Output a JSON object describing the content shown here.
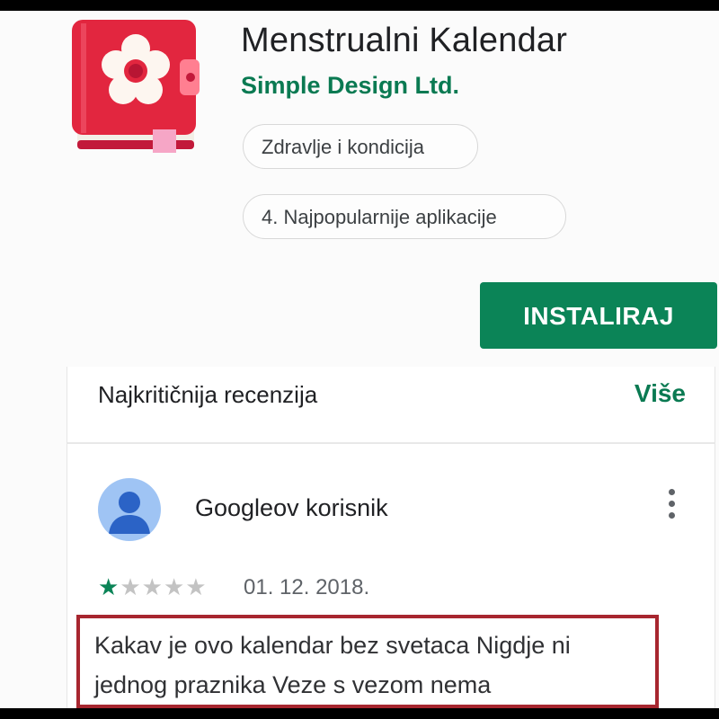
{
  "app": {
    "title": "Menstrualni Kalendar",
    "developer": "Simple Design Ltd.",
    "icon": "flower-diary-icon",
    "chips": {
      "category": "Zdravlje i kondicija",
      "rank": "4. Najpopularnije aplikacije"
    },
    "install_label": "INSTALIRAJ"
  },
  "review_section": {
    "title": "Najkritičnija recenzija",
    "more_label": "Više",
    "review": {
      "author": "Googleov korisnik",
      "rating": 1,
      "rating_max": 5,
      "date": "01. 12. 2018.",
      "text": "Kakav je ovo kalendar bez svetaca Nigdje ni jednog praznika Veze s vezom nema"
    }
  },
  "colors": {
    "accent_green": "#0b8457",
    "icon_red": "#e2263f",
    "highlight_border": "#a7262f",
    "avatar_blue": "#9fc4f4"
  }
}
